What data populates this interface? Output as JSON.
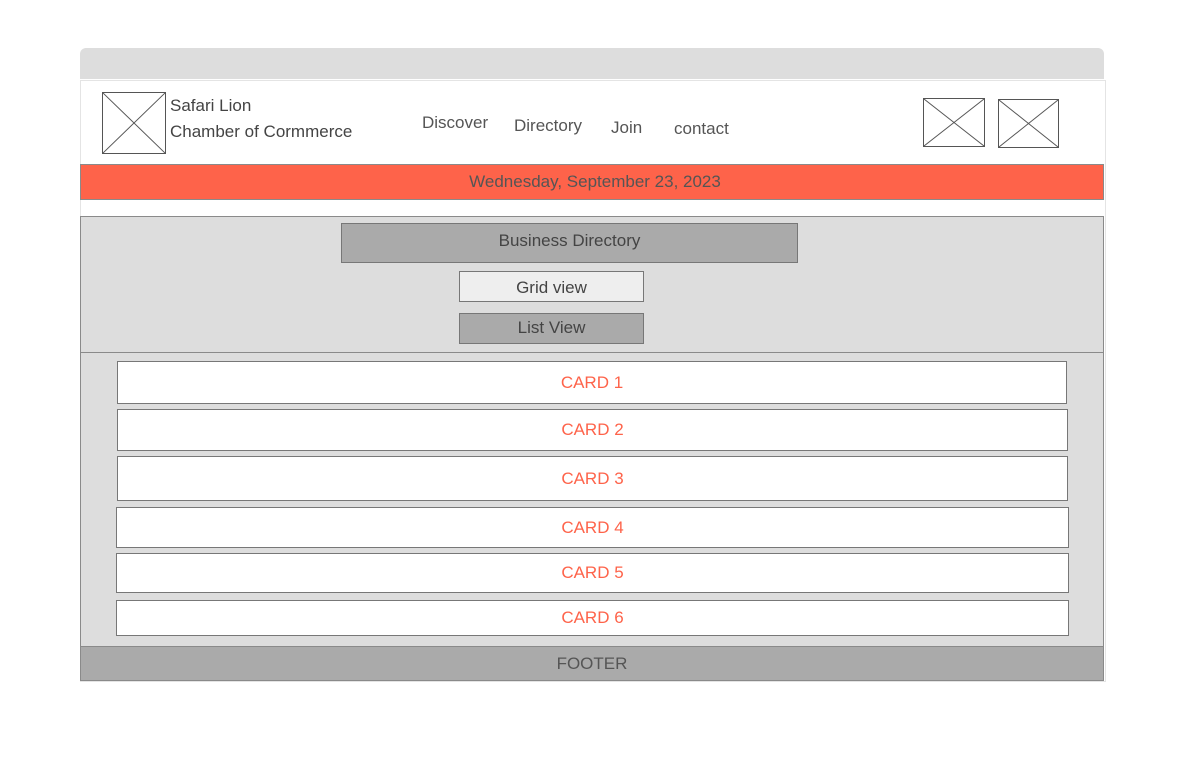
{
  "brand": {
    "name_line1": "Safari Lion",
    "name_line2": "Chamber of Cormmerce"
  },
  "nav": {
    "items": [
      "Discover",
      "Directory",
      "Join",
      "contact"
    ]
  },
  "date_bar": {
    "text": "Wednesday, September 23, 2023"
  },
  "directory": {
    "title": "Business Directory",
    "grid_view_label": "Grid view",
    "list_view_label": "List View"
  },
  "cards": [
    "CARD 1",
    "CARD 2",
    "CARD 3",
    "CARD 4",
    "CARD 5",
    "CARD 6"
  ],
  "footer": {
    "label": "FOOTER"
  },
  "colors": {
    "accent": "#fe634a",
    "panel_gray": "#dddddd",
    "button_gray": "#aaaaaa",
    "text_gray": "#444444"
  }
}
